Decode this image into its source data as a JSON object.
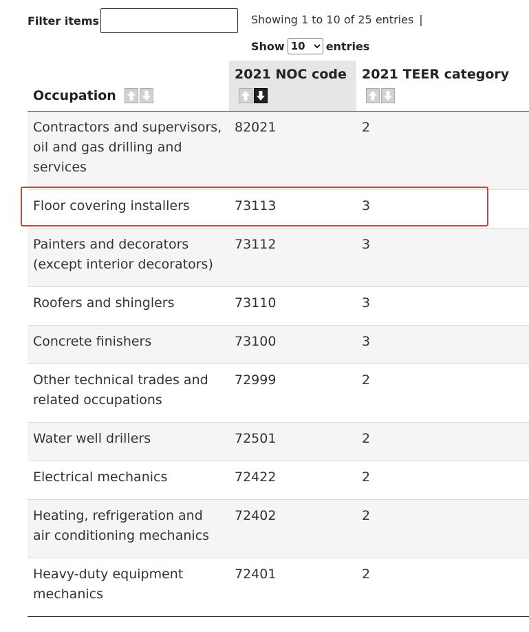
{
  "filter": {
    "label": "Filter items",
    "value": ""
  },
  "info": {
    "text": "Showing 1 to 10 of 25 entries",
    "separator": "|"
  },
  "length": {
    "prefix": "Show",
    "selected": "10",
    "suffix": "entries"
  },
  "columns": [
    {
      "label": "Occupation",
      "sort": "none"
    },
    {
      "label": "2021 NOC code",
      "sort": "descending"
    },
    {
      "label": "2021 TEER category",
      "sort": "none"
    }
  ],
  "rows": [
    {
      "occupation": "Contractors and supervisors, oil and gas drilling and services",
      "noc": "82021",
      "teer": "2"
    },
    {
      "occupation": "Floor covering installers",
      "noc": "73113",
      "teer": "3"
    },
    {
      "occupation": "Painters and decorators (except interior decorators)",
      "noc": "73112",
      "teer": "3"
    },
    {
      "occupation": "Roofers and shinglers",
      "noc": "73110",
      "teer": "3"
    },
    {
      "occupation": "Concrete finishers",
      "noc": "73100",
      "teer": "3"
    },
    {
      "occupation": "Other technical trades and related occupations",
      "noc": "72999",
      "teer": "2"
    },
    {
      "occupation": "Water well drillers",
      "noc": "72501",
      "teer": "2"
    },
    {
      "occupation": "Electrical mechanics",
      "noc": "72422",
      "teer": "2"
    },
    {
      "occupation": "Heating, refrigeration and air conditioning mechanics",
      "noc": "72402",
      "teer": "2"
    },
    {
      "occupation": "Heavy-duty equipment mechanics",
      "noc": "72401",
      "teer": "2"
    }
  ],
  "highlighted_row": 1,
  "colors": {
    "highlight": "#d93a3a",
    "stripe": "#f5f5f5",
    "sorted_header": "#e6e6e6"
  }
}
